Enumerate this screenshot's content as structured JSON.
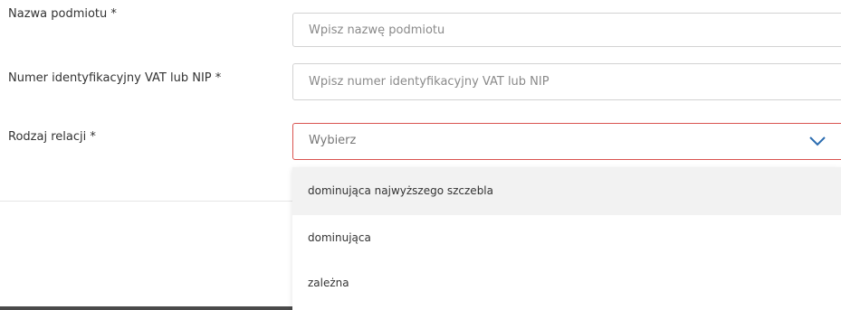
{
  "form": {
    "entity_name": {
      "label": "Nazwa podmiotu *",
      "placeholder": "Wpisz nazwę podmiotu",
      "value": ""
    },
    "vat_id": {
      "label": "Numer identyfikacyjny VAT lub NIP *",
      "placeholder": "Wpisz numer identyfikacyjny VAT lub NIP",
      "value": ""
    },
    "relation_type": {
      "label": "Rodzaj relacji *",
      "selected": "Wybierz",
      "icon": "chevron-down-icon",
      "border_color": "#d9534f",
      "icon_color": "#2b6cb0",
      "options": [
        "dominująca najwyższego szczebla",
        "dominująca",
        "zależna"
      ]
    }
  }
}
